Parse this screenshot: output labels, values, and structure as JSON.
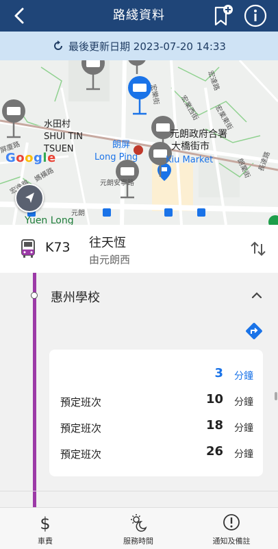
{
  "header": {
    "title": "路綫資料"
  },
  "update_bar": {
    "text": "最後更新日期 2023-07-20 14:33"
  },
  "map": {
    "labels": {
      "shui_tin_1": "水田村",
      "shui_tin_2": "SHUI TIN",
      "shui_tin_3": "TSUEN",
      "long_ping_zh": "朗屏",
      "long_ping_en": "Long Ping",
      "govt_1": "元朗政府合署",
      "govt_2": "大橋街市",
      "kiu_market": "Kiu Market",
      "yuen_long": "Yuen Long",
      "yuen_long_zh": "元朗",
      "yl_road": "元朗安寧路",
      "street_1": "宏業西街",
      "street_2": "宏業東街",
      "street_3": "青山公路",
      "street_4": "鳳攸北街",
      "street_5": "宏達路",
      "street_6": "朗業街",
      "street_7": "長達路",
      "street_8": "宏樂街",
      "street_9": "宏逸路",
      "street_10": "屏廈路",
      "street_11": "媽橫路"
    },
    "google": [
      "G",
      "o",
      "o",
      "g",
      "l",
      "e"
    ],
    "google_colors": [
      "#4285F4",
      "#EA4335",
      "#FBBC05",
      "#4285F4",
      "#34A853",
      "#EA4335"
    ],
    "accent_stop": "#1a73e8"
  },
  "route": {
    "number": "K73",
    "destination": "往天恆",
    "origin": "由元朗西",
    "line_color": "#9c3aa7"
  },
  "stop": {
    "name": "惠州學校",
    "etas": [
      {
        "label": "",
        "minutes": "3",
        "unit": "分鐘"
      },
      {
        "label": "預定班次",
        "minutes": "10",
        "unit": "分鐘"
      },
      {
        "label": "預定班次",
        "minutes": "18",
        "unit": "分鐘"
      },
      {
        "label": "預定班次",
        "minutes": "26",
        "unit": "分鐘"
      }
    ]
  },
  "bottom_nav": {
    "fare": "車費",
    "service_hours": "服務時間",
    "notices": "通知及備註"
  }
}
